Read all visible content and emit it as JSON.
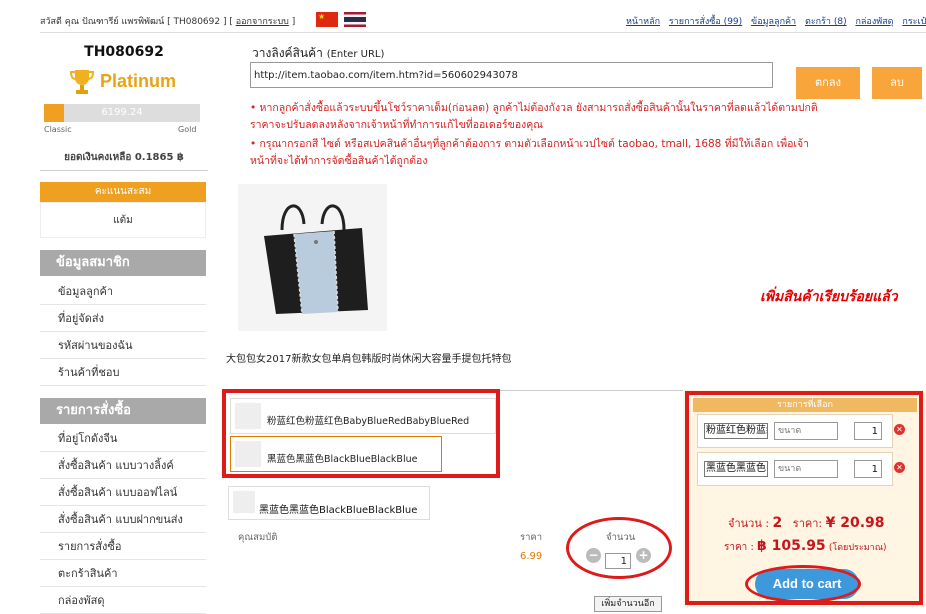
{
  "topbar": {
    "greeting": "สวัสดี คุณ ปัณฑารีย์ แพรพิพัฒน์ [ TH080692 ] [",
    "logout": "ออกจากระบบ",
    "greeting_end": "]",
    "nav": [
      "หน้าหลัก",
      "รายการสั่งซื้อ (99)",
      "ข้อมูลลูกค้า",
      "ตะกร้า (8)",
      "กล่องพัสดุ",
      "กระเป๋"
    ]
  },
  "member": {
    "id": "TH080692",
    "tier": "Platinum",
    "points": "6199.24",
    "progress_fraction": 0.13,
    "tier_from": "Classic",
    "tier_to": "Gold",
    "balance": "ยอดเงินคงเหลือ 0.1865 ฿"
  },
  "points_box": {
    "header": "คะแนนสะสม",
    "value": "แต้ม"
  },
  "sidebar": {
    "member_section": "ข้อมูลสมาชิก",
    "member_items": [
      "ข้อมูลลูกค้า",
      "ที่อยู่จัดส่ง",
      "รหัสผ่านของฉัน",
      "ร้านค้าที่ชอบ"
    ],
    "order_section": "รายการสั่งซื้อ",
    "order_items": [
      "ที่อยู่โกดังจีน",
      "สั่งซื้อสินค้า แบบวางลิ้งค์",
      "สั่งซื้อสินค้า แบบออฟไลน์",
      "สั่งซื้อสินค้า แบบฝากขนส่ง",
      "รายการสั่งซื้อ",
      "ตะกร้าสินค้า",
      "กล่องพัสดุ"
    ]
  },
  "url_form": {
    "label": "วางลิงค์สินค้า",
    "label_en": "(Enter URL)",
    "value": "http://item.taobao.com/item.htm?id=560602943078",
    "ok_button": "ตกลง",
    "delete_button": "ลบ"
  },
  "notices": [
    "• หากลูกค้าสั่งซื้อแล้วระบบขึ้นโชว์ราคาเต็ม(ก่อนลด) ลูกค้าไม่ต้องกังวล ยังสามารถสั่งซื้อสินค้านั้นในราคาที่ลดแล้วได้ตามปกติ",
    "ราคาจะปรับลดลงหลังจากเจ้าหน้าที่ทำการแก้ไขที่ออเดอร์ของคุณ",
    "• กรุณากรอกสี ไซต์ หรือสเปคสินค้าอื่นๆที่ลูกค้าต้องการ ตามตัวเลือกหน้าเวปไซต์ taobao, tmall, 1688 ที่มีให้เลือก เพื่อเจ้า",
    "หน้าที่จะได้ทำการจัดซื้อสินค้าได้ถูกต้อง"
  ],
  "product": {
    "added_message": "เพิ่มสินค้าเรียบร้อยแล้ว",
    "title": "大包包女2017新款女包单肩包韩版时尚休闲大容量手提包托特包",
    "options": [
      "粉蓝红色粉蓝红色BabyBlueRedBabyBlueRed",
      "黑蓝色黑蓝色BlackBlueBlackBlue"
    ],
    "selected_option": "黑蓝色黑蓝色BlackBlueBlackBlue",
    "header_property": "คุณสมบัติ",
    "header_price": "ราคา",
    "header_quantity": "จำนวน",
    "price": "6.99",
    "quantity": "1",
    "add_more": "เพิ่มจำนวนอีก"
  },
  "cart": {
    "header": "รายการที่เลือก",
    "rows": [
      {
        "name": "粉蓝红色粉蓝红色",
        "size_placeholder": "ขนาด",
        "qty": "1"
      },
      {
        "name": "黑蓝色黑蓝色",
        "size_placeholder": "ขนาด",
        "qty": "1"
      }
    ],
    "qty_label": "จำนวน :",
    "qty_total": "2",
    "price_label": "ราคา:",
    "price_cny": "¥ 20.98",
    "thb_label": "ราคา :",
    "price_thb": "฿ 105.95",
    "estimate": "(โดยประมาณ)",
    "add_to_cart": "Add to cart"
  },
  "colors": {
    "accent_orange": "#f0a020",
    "notice_red": "#d61f1f",
    "annotation_red": "#dd1b1b",
    "cart_bg": "#fff5e2",
    "cart_button": "#3e98dc",
    "link_blue": "#1a3d8f"
  }
}
